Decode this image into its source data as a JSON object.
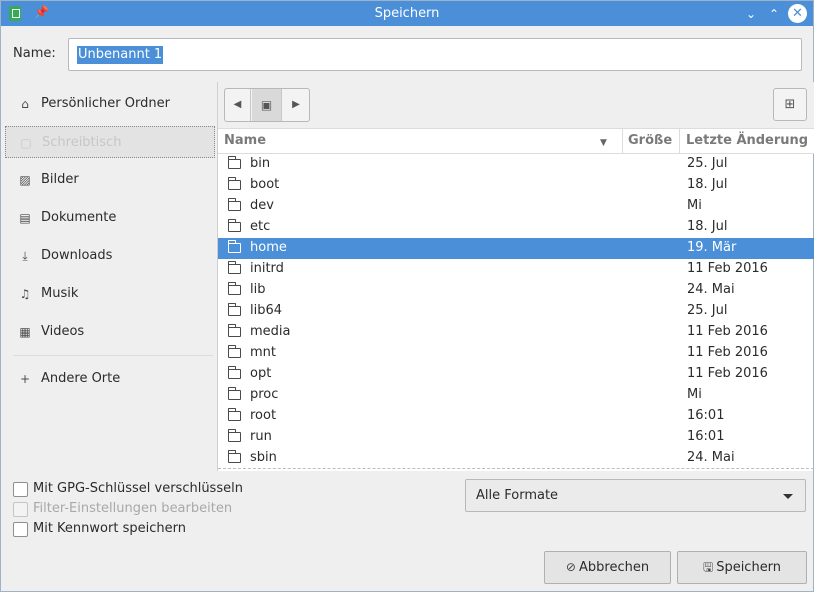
{
  "window": {
    "title": "Speichern",
    "pin_glyph": "📌",
    "minimize_glyph": "⌄",
    "maximize_glyph": "⌃",
    "close_glyph": "✕"
  },
  "name_row": {
    "label": "Name:",
    "value": "Unbenannt 1"
  },
  "sidebar": {
    "items": [
      {
        "label": "Persönlicher Ordner",
        "icon": "home-icon",
        "glyph": "⌂"
      },
      {
        "label": "Schreibtisch",
        "icon": "desktop-icon",
        "glyph": "▢"
      },
      {
        "label": "Bilder",
        "icon": "pictures-icon",
        "glyph": "▨"
      },
      {
        "label": "Dokumente",
        "icon": "documents-icon",
        "glyph": "▤"
      },
      {
        "label": "Downloads",
        "icon": "download-icon",
        "glyph": "⤓"
      },
      {
        "label": "Musik",
        "icon": "music-icon",
        "glyph": "♫"
      },
      {
        "label": "Videos",
        "icon": "video-icon",
        "glyph": "▦"
      },
      {
        "label": "Andere Orte",
        "icon": "plus-icon",
        "glyph": "+"
      }
    ]
  },
  "toolbar": {
    "back_glyph": "◀",
    "drive_glyph": "▣",
    "forward_glyph": "▶",
    "new_folder_glyph": "⊞"
  },
  "columns": {
    "name": "Name",
    "size": "Größe",
    "modified": "Letzte Änderung"
  },
  "files": [
    {
      "name": "bin",
      "date": "25. Jul"
    },
    {
      "name": "boot",
      "date": "18. Jul"
    },
    {
      "name": "dev",
      "date": "Mi"
    },
    {
      "name": "etc",
      "date": "18. Jul"
    },
    {
      "name": "home",
      "date": "19. Mär",
      "selected": true
    },
    {
      "name": "initrd",
      "date": "11 Feb 2016"
    },
    {
      "name": "lib",
      "date": "24. Mai"
    },
    {
      "name": "lib64",
      "date": "25. Jul"
    },
    {
      "name": "media",
      "date": "11 Feb 2016"
    },
    {
      "name": "mnt",
      "date": "11 Feb 2016"
    },
    {
      "name": "opt",
      "date": "11 Feb 2016"
    },
    {
      "name": "proc",
      "date": "Mi"
    },
    {
      "name": "root",
      "date": "16:01"
    },
    {
      "name": "run",
      "date": "16:01"
    },
    {
      "name": "sbin",
      "date": "24. Mai"
    }
  ],
  "options": {
    "gpg": "Mit GPG-Schlüssel verschlüsseln",
    "filter": "Filter-Einstellungen bearbeiten",
    "password": "Mit Kennwort speichern"
  },
  "format": {
    "selected": "Alle Formate"
  },
  "buttons": {
    "cancel": "Abbrechen",
    "cancel_glyph": "⊘",
    "save": "Speichern",
    "save_glyph": "🖫"
  },
  "colors": {
    "accent": "#4a8fd8",
    "window_bg": "#efefef"
  }
}
